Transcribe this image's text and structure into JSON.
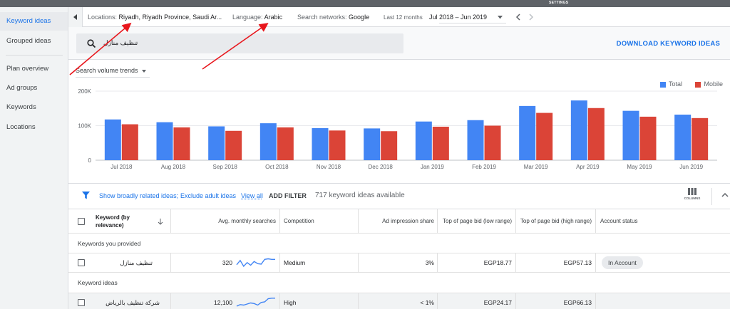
{
  "topbar": {
    "settings_label": "SETTINGS"
  },
  "sidebar": {
    "items": [
      {
        "label": "Keyword ideas",
        "active": true
      },
      {
        "label": "Grouped ideas"
      },
      {
        "label": "Plan overview"
      },
      {
        "label": "Ad groups"
      },
      {
        "label": "Keywords"
      },
      {
        "label": "Locations"
      }
    ]
  },
  "filters": {
    "locations_label": "Locations:",
    "locations_value": "Riyadh, Riyadh Province, Saudi Ar...",
    "language_label": "Language:",
    "language_value": "Arabic",
    "networks_label": "Search networks:",
    "networks_value": "Google",
    "period_label": "Last 12 months",
    "period_value": "Jul 2018 – Jun 2019"
  },
  "search": {
    "value": "تنظيف منازل"
  },
  "download_label": "DOWNLOAD KEYWORD IDEAS",
  "chart_select": "Search volume trends",
  "chart_data": {
    "type": "bar",
    "categories": [
      "Jul 2018",
      "Aug 2018",
      "Sep 2018",
      "Oct 2018",
      "Nov 2018",
      "Dec 2018",
      "Jan 2019",
      "Feb 2019",
      "Mar 2019",
      "Apr 2019",
      "May 2019",
      "Jun 2019"
    ],
    "series": [
      {
        "name": "Total",
        "color": "#4285f4",
        "values": [
          118000,
          110000,
          98000,
          107000,
          93000,
          92000,
          112000,
          116000,
          157000,
          173000,
          143000,
          132000
        ]
      },
      {
        "name": "Mobile",
        "color": "#db4437",
        "values": [
          104000,
          95000,
          85000,
          95000,
          86000,
          84000,
          97000,
          100000,
          137000,
          151000,
          126000,
          122000
        ]
      }
    ],
    "yticks": [
      "0",
      "100K",
      "200K"
    ],
    "ylim": [
      0,
      200000
    ],
    "legend_position": "top-right",
    "grid": true
  },
  "table_toolbar": {
    "show_broadly": "Show broadly related ideas;",
    "exclude_adult": "Exclude adult ideas",
    "view_all": "View all",
    "add_filter": "ADD FILTER",
    "count_text": "717 keyword ideas available",
    "columns_label": "COLUMNS"
  },
  "table": {
    "headers": {
      "keyword": "Keyword (by relevance)",
      "avg": "Avg. monthly searches",
      "competition": "Competition",
      "impression": "Ad impression share",
      "bid_low": "Top of page bid (low range)",
      "bid_high": "Top of page bid (high range)",
      "status": "Account status"
    },
    "group1": "Keywords you provided",
    "group2": "Keyword ideas",
    "rows": [
      {
        "keyword": "تنظيف منازل",
        "avg": "320",
        "trend": [
          0.35,
          0.75,
          0.2,
          0.55,
          0.3,
          0.65,
          0.45,
          0.4,
          0.85,
          0.9,
          0.85,
          0.85
        ],
        "competition": "Medium",
        "impression": "3%",
        "bid_low": "EGP18.77",
        "bid_high": "EGP57.13",
        "status": "In Account"
      },
      {
        "keyword": "شركة تنظيف بالرياض",
        "avg": "12,100",
        "trend": [
          0.2,
          0.35,
          0.3,
          0.4,
          0.5,
          0.45,
          0.3,
          0.55,
          0.6,
          0.9,
          0.95,
          0.95
        ],
        "competition": "High",
        "impression": "< 1%",
        "bid_low": "EGP24.17",
        "bid_high": "EGP66.13",
        "status": ""
      }
    ]
  }
}
